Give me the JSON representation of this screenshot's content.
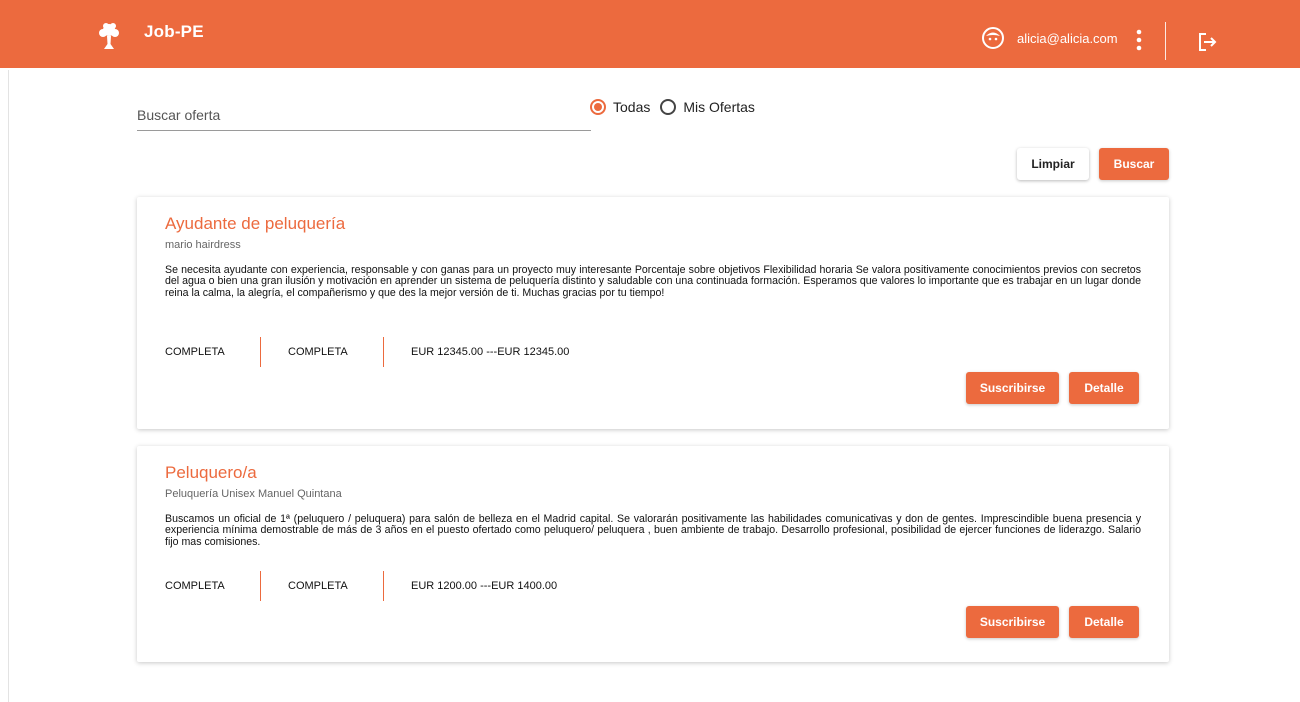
{
  "header": {
    "app_title": "Job-PE",
    "user_email": "alicia@alicia.com",
    "icons": [
      "tree-logo-icon",
      "avatar-face-icon",
      "more-vert-icon",
      "logout-icon"
    ]
  },
  "search": {
    "placeholder": "Buscar oferta",
    "value": "",
    "filter_options": [
      "Todas",
      "Mis Ofertas"
    ],
    "selected_filter": "Todas",
    "clear_label": "Limpiar",
    "search_label": "Buscar"
  },
  "offers": [
    {
      "title": "Ayudante de peluquería",
      "company": "mario hairdress",
      "description": "Se necesita ayudante con experiencia, responsable y con ganas para un proyecto muy interesante Porcentaje sobre objetivos Flexibilidad horaria Se valora positivamente conocimientos previos con secretos del agua o bien una gran ilusión y motivación en aprender un sistema de peluquería distinto y saludable con una continuada formación. Esperamos que valores lo importante que es trabajar en un lugar donde reina la calma, la alegría, el compañerismo y que des la mejor versión de ti. Muchas gracias por tu tiempo!",
      "meta": [
        "COMPLETA",
        "COMPLETA",
        "EUR 12345.00 ---EUR 12345.00"
      ],
      "subscribe_label": "Suscribirse",
      "detail_label": "Detalle"
    },
    {
      "title": "Peluquero/a",
      "company": "Peluquería Unisex Manuel Quintana",
      "description": "Buscamos un oficial de 1ª (peluquero / peluquera) para salón de belleza en el Madrid capital. Se valorarán positivamente las habilidades comunicativas y don de gentes. Imprescindible buena presencia y experiencia mínima demostrable de más de 3 años en el puesto ofertado como peluquero/ peluquera , buen ambiente de trabajo. Desarrollo profesional, posibilidad de ejercer funciones de liderazgo. Salario fijo mas comisiones.",
      "meta": [
        "COMPLETA",
        "COMPLETA",
        "EUR 1200.00 ---EUR 1400.00"
      ],
      "subscribe_label": "Suscribirse",
      "detail_label": "Detalle"
    }
  ],
  "colors": {
    "brand": "#ec6a3e",
    "text": "#222222",
    "muted": "#666666"
  }
}
